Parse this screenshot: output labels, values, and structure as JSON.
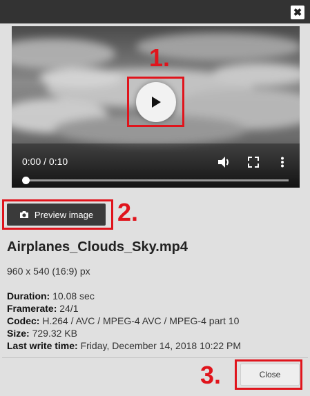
{
  "dialog": {
    "close_icon_glyph": "✖"
  },
  "video": {
    "time_display": "0:00 / 0:10",
    "progress_fraction": 0
  },
  "annotations": {
    "marker_1": "1.",
    "marker_2": "2.",
    "marker_3": "3.",
    "highlight_color": "#e0141c"
  },
  "preview_button": {
    "label": "Preview image"
  },
  "file": {
    "name": "Airplanes_Clouds_Sky.mp4",
    "dimensions": "960 x 540 (16:9) px",
    "details": [
      {
        "key": "Duration:",
        "value": "10.08 sec"
      },
      {
        "key": "Framerate:",
        "value": "24/1"
      },
      {
        "key": "Codec:",
        "value": "H.264 / AVC / MPEG-4 AVC / MPEG-4 part 10"
      },
      {
        "key": "Size:",
        "value": "729.32 KB"
      },
      {
        "key": "Last write time:",
        "value": "Friday, December 14, 2018 10:22 PM"
      }
    ]
  },
  "footer": {
    "close_label": "Close"
  },
  "icons": [
    "close-icon",
    "play-icon",
    "volume-icon",
    "fullscreen-icon",
    "more-options-icon",
    "camera-icon"
  ]
}
